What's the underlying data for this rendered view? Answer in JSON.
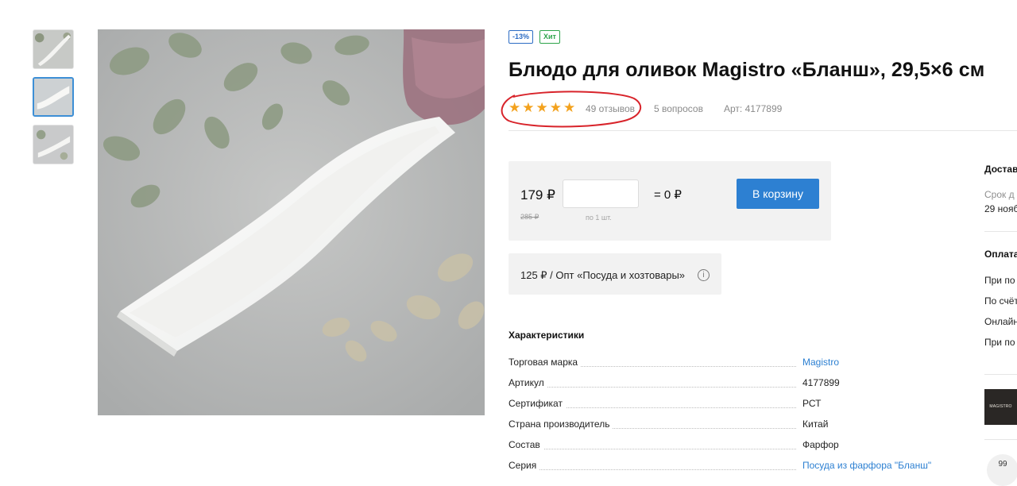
{
  "badges": {
    "discount": "-13%",
    "hit": "Хит"
  },
  "product": {
    "title": "Блюдо для оливок Magistro «Бланш», 29,5×6 см",
    "rating": 5,
    "reviews": "49 отзывов",
    "questions": "5 вопросов",
    "article": "Арт: 4177899"
  },
  "price": {
    "current": "179 ₽",
    "old": "285 ₽",
    "qty_value": "",
    "qty_note": "по 1 шт.",
    "total": "= 0 ₽",
    "cart_button": "В корзину"
  },
  "wholesale": {
    "text": "125 ₽ / Опт «Посуда и хозтовары»",
    "info_icon": "info-icon"
  },
  "characteristics": {
    "title": "Характеристики",
    "rows": [
      {
        "key": "Торговая марка",
        "value": "Magistro",
        "link": true
      },
      {
        "key": "Артикул",
        "value": "4177899",
        "link": false
      },
      {
        "key": "Сертификат",
        "value": "РСТ",
        "link": false
      },
      {
        "key": "Страна производитель",
        "value": "Китай",
        "link": false
      },
      {
        "key": "Состав",
        "value": "Фарфор",
        "link": false
      },
      {
        "key": "Серия",
        "value": "Посуда из фарфора \"Бланш\"",
        "link": true
      }
    ]
  },
  "sidebar": {
    "delivery_title": "Достав",
    "delivery_term_label": "Срок д",
    "delivery_date": "29 нояб",
    "payment_title": "Оплата",
    "payment_items": [
      "При по",
      "По счёт",
      "Онлайн",
      "При по"
    ],
    "brand_logo_text": "MAGISTRO",
    "round_text": "99"
  },
  "colors": {
    "accent": "#2d80d2",
    "star": "#f3a21e",
    "annotation": "#d8232a",
    "hit": "#2ca44a"
  }
}
